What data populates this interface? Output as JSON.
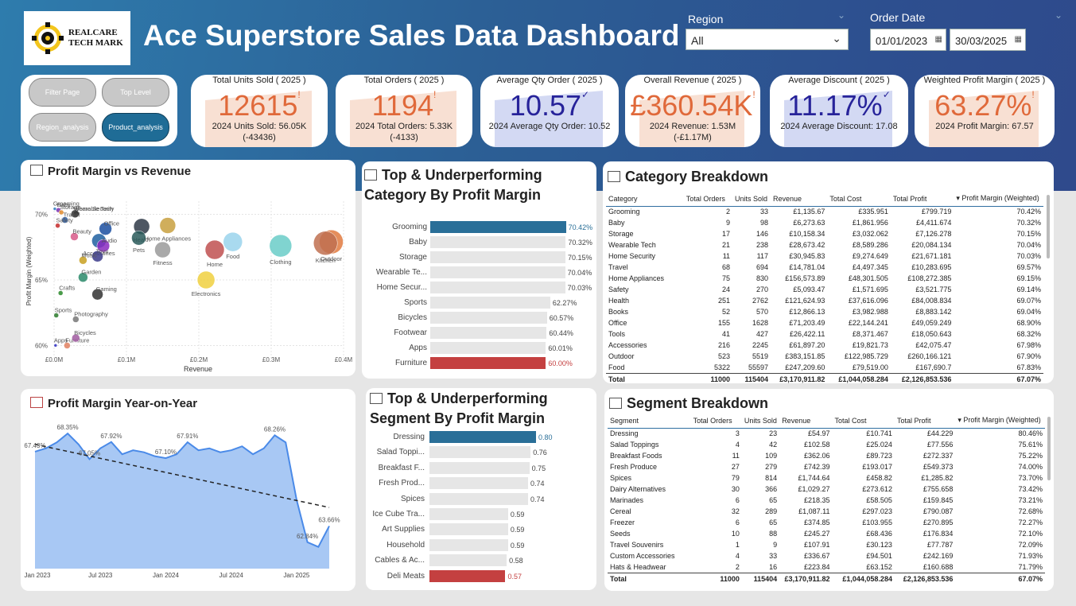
{
  "header": {
    "logo_text_line1": "REALCARE",
    "logo_text_line2": "TECH MARK",
    "title": "Ace Superstore Sales Data Dashboard",
    "region_label": "Region",
    "region_value": "All",
    "order_date_label": "Order Date",
    "date_from": "01/01/2023",
    "date_to": "30/03/2025"
  },
  "nav": {
    "filter_page": "Filter Page",
    "top_level": "Top Level",
    "region_analysis": "Region_analysis",
    "product_analysis": "Product_analysis"
  },
  "kpis": [
    {
      "title": "Total Units Sold ( 2025 )",
      "value": "12615",
      "sub1": "2024 Units Sold: 56.05K",
      "sub2": "(-43436)",
      "color": "#e0693a",
      "icon": "!"
    },
    {
      "title": "Total Orders ( 2025 )",
      "value": "1194",
      "sub1": "2024 Total Orders: 5.33K",
      "sub2": "(-4133)",
      "color": "#e0693a",
      "icon": "!"
    },
    {
      "title": "Average Qty Order ( 2025 )",
      "value": "10.57",
      "sub1": "2024 Average Qty Order: 10.52",
      "sub2": "",
      "color": "#27239a",
      "icon": "✓"
    },
    {
      "title": "Overall Revenue ( 2025 )",
      "value": "£360.54K",
      "sub1": "2024 Revenue: 1.53M",
      "sub2": "(-£1.17M)",
      "color": "#e0693a",
      "icon": "!"
    },
    {
      "title": "Average Discount ( 2025 )",
      "value": "11.17%",
      "sub1": "2024 Average Discount: 17.08",
      "sub2": "",
      "color": "#27239a",
      "icon": "✓"
    },
    {
      "title": "Weighted Profit Margin ( 2025 )",
      "value": "63.27%",
      "sub1": "2024 Profit Margin: 67.57",
      "sub2": "",
      "color": "#e0693a",
      "icon": "!"
    }
  ],
  "scatter": {
    "title": "Profit Margin vs Revenue",
    "chart_data": {
      "type": "scatter",
      "xlabel": "Revenue",
      "ylabel": "Profit Margin (Weighted)",
      "x_ticks": [
        "£0.0M",
        "£0.1M",
        "£0.2M",
        "£0.3M",
        "£0.4M"
      ],
      "y_ticks": [
        "70%",
        "65%",
        "60%"
      ],
      "xlim": [
        0,
        0.4
      ],
      "ylim": [
        59,
        71
      ],
      "points": [
        {
          "name": "Home Security",
          "x": 0.031,
          "y": 70.03,
          "color": "#555555",
          "r": 4
        },
        {
          "name": "Wearable Tech",
          "x": 0.029,
          "y": 70.04,
          "color": "#333333",
          "r": 5
        },
        {
          "name": "Baby",
          "x": 0.006,
          "y": 70.32,
          "color": "#7a2fb0",
          "r": 3
        },
        {
          "name": "Storage",
          "x": 0.01,
          "y": 70.15,
          "color": "#e08a2a",
          "r": 3
        },
        {
          "name": "Grooming",
          "x": 0.001,
          "y": 70.42,
          "color": "#2a7ac0",
          "r": 2
        },
        {
          "name": "Travel",
          "x": 0.015,
          "y": 69.57,
          "color": "#2a5aa0",
          "r": 4
        },
        {
          "name": "Accessories",
          "x": 0.062,
          "y": 67.98,
          "color": "#1f5fa0",
          "r": 9
        },
        {
          "name": "Office",
          "x": 0.071,
          "y": 68.9,
          "color": "#1b4fa0",
          "r": 8
        },
        {
          "name": "Safety",
          "x": 0.005,
          "y": 69.14,
          "color": "#c42a2a",
          "r": 3
        },
        {
          "name": "Audio",
          "x": 0.068,
          "y": 67.6,
          "color": "#8a2ac0",
          "r": 8
        },
        {
          "name": "Beauty",
          "x": 0.028,
          "y": 68.3,
          "color": "#d85a8a",
          "r": 5
        },
        {
          "name": "Toys",
          "x": 0.06,
          "y": 66.8,
          "color": "#3a3a8a",
          "r": 7
        },
        {
          "name": "Music",
          "x": 0.04,
          "y": 66.5,
          "color": "#c8a020",
          "r": 5
        },
        {
          "name": "Garden",
          "x": 0.04,
          "y": 65.2,
          "color": "#2a8a6a",
          "r": 6
        },
        {
          "name": "Crafts",
          "x": 0.009,
          "y": 64.0,
          "color": "#2a8a2a",
          "r": 3
        },
        {
          "name": "Gaming",
          "x": 0.06,
          "y": 63.9,
          "color": "#333333",
          "r": 7
        },
        {
          "name": "Sports",
          "x": 0.003,
          "y": 62.3,
          "color": "#2a7a2a",
          "r": 3
        },
        {
          "name": "Photography",
          "x": 0.03,
          "y": 62.0,
          "color": "#777777",
          "r": 4
        },
        {
          "name": "Furniture",
          "x": 0.018,
          "y": 60.0,
          "color": "#e08060",
          "r": 4
        },
        {
          "name": "Apps",
          "x": 0.002,
          "y": 60.01,
          "color": "#2a2ac0",
          "r": 2
        },
        {
          "name": "Bicycles",
          "x": 0.03,
          "y": 60.57,
          "color": "#a05aa0",
          "r": 5
        },
        {
          "name": "Health",
          "x": 0.121,
          "y": 69.07,
          "color": "#2f3a48",
          "r": 10
        },
        {
          "name": "Home Appliances",
          "x": 0.157,
          "y": 69.15,
          "color": "#c8a040",
          "r": 10
        },
        {
          "name": "Pets",
          "x": 0.117,
          "y": 68.2,
          "color": "#2a5a5a",
          "r": 9
        },
        {
          "name": "Fitness",
          "x": 0.15,
          "y": 67.3,
          "color": "#9a9a9a",
          "r": 10
        },
        {
          "name": "Home",
          "x": 0.222,
          "y": 67.3,
          "color": "#c05050",
          "r": 12
        },
        {
          "name": "Food",
          "x": 0.247,
          "y": 67.9,
          "color": "#9ad4ec",
          "r": 12
        },
        {
          "name": "Electronics",
          "x": 0.21,
          "y": 65.0,
          "color": "#f0d040",
          "r": 11
        },
        {
          "name": "Clothing",
          "x": 0.313,
          "y": 67.6,
          "color": "#6acdc8",
          "r": 14
        },
        {
          "name": "Outdoor",
          "x": 0.383,
          "y": 67.9,
          "color": "#e07a40",
          "r": 15
        },
        {
          "name": "Kitchen",
          "x": 0.375,
          "y": 67.8,
          "color": "#c07050",
          "r": 15
        }
      ]
    }
  },
  "category_bars": {
    "title_line1": "Top & Underperforming",
    "title_line2": "Category By Profit Margin",
    "chart_data": {
      "type": "bar",
      "categories": [
        "Grooming",
        "Baby",
        "Storage",
        "Wearable Te...",
        "Home Secur...",
        "Sports",
        "Bicycles",
        "Footwear",
        "Apps",
        "Furniture"
      ],
      "values": [
        70.42,
        70.32,
        70.15,
        70.04,
        70.03,
        62.27,
        60.57,
        60.44,
        60.01,
        60.0
      ],
      "labels": [
        "70.42%",
        "70.32%",
        "70.15%",
        "70.04%",
        "70.03%",
        "62.27%",
        "60.57%",
        "60.44%",
        "60.01%",
        "60.00%"
      ],
      "top_color": "#2a6f98",
      "bottom_color": "#c44040",
      "xlim": [
        0,
        71
      ]
    }
  },
  "segment_bars": {
    "title_line1": "Top & Underperforming",
    "title_line2": "Segment By Profit Margin",
    "chart_data": {
      "type": "bar",
      "categories": [
        "Dressing",
        "Salad Toppi...",
        "Breakfast F...",
        "Fresh Prod...",
        "Spices",
        "Ice Cube Tra...",
        "Art Supplies",
        "Household",
        "Cables & Ac...",
        "Deli Meats"
      ],
      "values": [
        0.8,
        0.76,
        0.75,
        0.74,
        0.74,
        0.59,
        0.59,
        0.59,
        0.58,
        0.57
      ],
      "labels": [
        "0.80",
        "0.76",
        "0.75",
        "0.74",
        "0.74",
        "0.59",
        "0.59",
        "0.59",
        "0.58",
        "0.57"
      ],
      "top_color": "#2a6f98",
      "bottom_color": "#c44040",
      "xlim": [
        0,
        0.8
      ]
    }
  },
  "category_table": {
    "title": "Category Breakdown",
    "columns": [
      "Category",
      "Total Orders",
      "Units Sold",
      "Revenue",
      "Total Cost",
      "Total Profit",
      "Profit Margin (Weighted)"
    ],
    "rows": [
      [
        "Grooming",
        "2",
        "33",
        "£1,135.67",
        "£335.951",
        "£799.719",
        "70.42%"
      ],
      [
        "Baby",
        "9",
        "98",
        "£6,273.63",
        "£1,861.956",
        "£4,411.674",
        "70.32%"
      ],
      [
        "Storage",
        "17",
        "146",
        "£10,158.34",
        "£3,032.062",
        "£7,126.278",
        "70.15%"
      ],
      [
        "Wearable Tech",
        "21",
        "238",
        "£28,673.42",
        "£8,589.286",
        "£20,084.134",
        "70.04%"
      ],
      [
        "Home Security",
        "11",
        "117",
        "£30,945.83",
        "£9,274.649",
        "£21,671.181",
        "70.03%"
      ],
      [
        "Travel",
        "68",
        "694",
        "£14,781.04",
        "£4,497.345",
        "£10,283.695",
        "69.57%"
      ],
      [
        "Home Appliances",
        "75",
        "830",
        "£156,573.89",
        "£48,301.505",
        "£108,272.385",
        "69.15%"
      ],
      [
        "Safety",
        "24",
        "270",
        "£5,093.47",
        "£1,571.695",
        "£3,521.775",
        "69.14%"
      ],
      [
        "Health",
        "251",
        "2762",
        "£121,624.93",
        "£37,616.096",
        "£84,008.834",
        "69.07%"
      ],
      [
        "Books",
        "52",
        "570",
        "£12,866.13",
        "£3,982.988",
        "£8,883.142",
        "69.04%"
      ],
      [
        "Office",
        "155",
        "1628",
        "£71,203.49",
        "£22,144.241",
        "£49,059.249",
        "68.90%"
      ],
      [
        "Tools",
        "41",
        "427",
        "£26,422.11",
        "£8,371.467",
        "£18,050.643",
        "68.32%"
      ],
      [
        "Accessories",
        "216",
        "2245",
        "£61,897.20",
        "£19,821.73",
        "£42,075.47",
        "67.98%"
      ],
      [
        "Outdoor",
        "523",
        "5519",
        "£383,151.85",
        "£122,985.729",
        "£260,166.121",
        "67.90%"
      ],
      [
        "Food",
        "5322",
        "55597",
        "£247,209.60",
        "£79,519.00",
        "£167,690.7",
        "67.83%"
      ]
    ],
    "total": [
      "Total",
      "11000",
      "115404",
      "£3,170,911.82",
      "£1,044,058.284",
      "£2,126,853.536",
      "67.07%"
    ]
  },
  "segment_table": {
    "title": "Segment Breakdown",
    "columns": [
      "Segment",
      "Total Orders",
      "Units Sold",
      "Revenue",
      "Total Cost",
      "Total Profit",
      "Profit Margin (Weighted)"
    ],
    "rows": [
      [
        "Dressing",
        "3",
        "23",
        "£54.97",
        "£10.741",
        "£44.229",
        "80.46%"
      ],
      [
        "Salad Toppings",
        "4",
        "42",
        "£102.58",
        "£25.024",
        "£77.556",
        "75.61%"
      ],
      [
        "Breakfast Foods",
        "11",
        "109",
        "£362.06",
        "£89.723",
        "£272.337",
        "75.22%"
      ],
      [
        "Fresh Produce",
        "27",
        "279",
        "£742.39",
        "£193.017",
        "£549.373",
        "74.00%"
      ],
      [
        "Spices",
        "79",
        "814",
        "£1,744.64",
        "£458.82",
        "£1,285.82",
        "73.70%"
      ],
      [
        "Dairy Alternatives",
        "30",
        "366",
        "£1,029.27",
        "£273.612",
        "£755.658",
        "73.42%"
      ],
      [
        "Marinades",
        "6",
        "65",
        "£218.35",
        "£58.505",
        "£159.845",
        "73.21%"
      ],
      [
        "Cereal",
        "32",
        "289",
        "£1,087.11",
        "£297.023",
        "£790.087",
        "72.68%"
      ],
      [
        "Freezer",
        "6",
        "65",
        "£374.85",
        "£103.955",
        "£270.895",
        "72.27%"
      ],
      [
        "Seeds",
        "10",
        "88",
        "£245.27",
        "£68.436",
        "£176.834",
        "72.10%"
      ],
      [
        "Travel Souvenirs",
        "1",
        "9",
        "£107.91",
        "£30.123",
        "£77.787",
        "72.09%"
      ],
      [
        "Custom Accessories",
        "4",
        "33",
        "£336.67",
        "£94.501",
        "£242.169",
        "71.93%"
      ],
      [
        "Hats & Headwear",
        "2",
        "16",
        "£223.84",
        "£63.152",
        "£160.688",
        "71.79%"
      ]
    ],
    "total": [
      "Total",
      "11000",
      "115404",
      "£3,170,911.82",
      "£1,044,058.284",
      "£2,126,853.536",
      "67.07%"
    ]
  },
  "yoy": {
    "title": "Profit Margin Year-on-Year",
    "chart_data": {
      "type": "area",
      "x_ticks": [
        "Jan 2023",
        "Jul 2023",
        "Jan 2024",
        "Jul 2024",
        "Jan 2025"
      ],
      "values": [
        67.43,
        67.6,
        67.9,
        68.35,
        67.8,
        67.05,
        67.6,
        67.92,
        67.3,
        67.5,
        67.4,
        67.2,
        67.1,
        67.3,
        67.91,
        67.5,
        67.6,
        67.4,
        67.5,
        67.7,
        67.3,
        67.6,
        68.26,
        67.9,
        65.0,
        62.84,
        62.6,
        63.66
      ],
      "labels": [
        {
          "i": 0,
          "text": "67.43%"
        },
        {
          "i": 3,
          "text": "68.35%"
        },
        {
          "i": 5,
          "text": "67.05%"
        },
        {
          "i": 7,
          "text": "67.92%"
        },
        {
          "i": 12,
          "text": "67.10%"
        },
        {
          "i": 14,
          "text": "67.91%"
        },
        {
          "i": 22,
          "text": "68.26%"
        },
        {
          "i": 25,
          "text": "62.84%"
        },
        {
          "i": 27,
          "text": "63.66%"
        }
      ],
      "ylim": [
        61.5,
        69
      ],
      "trend": [
        67.8,
        64.6
      ],
      "area_color": "#a8c8f4",
      "line_color": "#4a8ae8"
    }
  }
}
